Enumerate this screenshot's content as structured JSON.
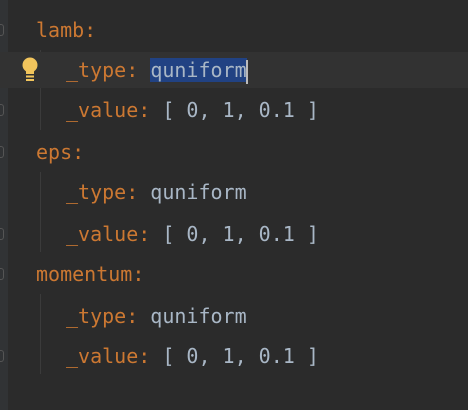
{
  "editor": {
    "selected_text": "quniform",
    "intention_icon": "lightbulb-icon",
    "colors": {
      "background": "#2b2b2b",
      "key": "#cc7832",
      "value": "#a9b7c6",
      "selection": "#214283",
      "current_line": "#323232",
      "bulb": "#f2c55c"
    },
    "lines": [
      {
        "key": "lamb",
        "colon": ":",
        "value": ""
      },
      {
        "key": "_type",
        "colon": ":",
        "value": "quniform"
      },
      {
        "key": "_value",
        "colon": ":",
        "value": " [ 0, 1, 0.1 ]"
      },
      {
        "key": "eps",
        "colon": ":",
        "value": ""
      },
      {
        "key": "_type",
        "colon": ":",
        "value": " quniform"
      },
      {
        "key": "_value",
        "colon": ":",
        "value": " [ 0, 1, 0.1 ]"
      },
      {
        "key": "momentum",
        "colon": ":",
        "value": ""
      },
      {
        "key": "_type",
        "colon": ":",
        "value": " quniform"
      },
      {
        "key": "_value",
        "colon": ":",
        "value": " [ 0, 1, 0.1 ]"
      }
    ]
  }
}
